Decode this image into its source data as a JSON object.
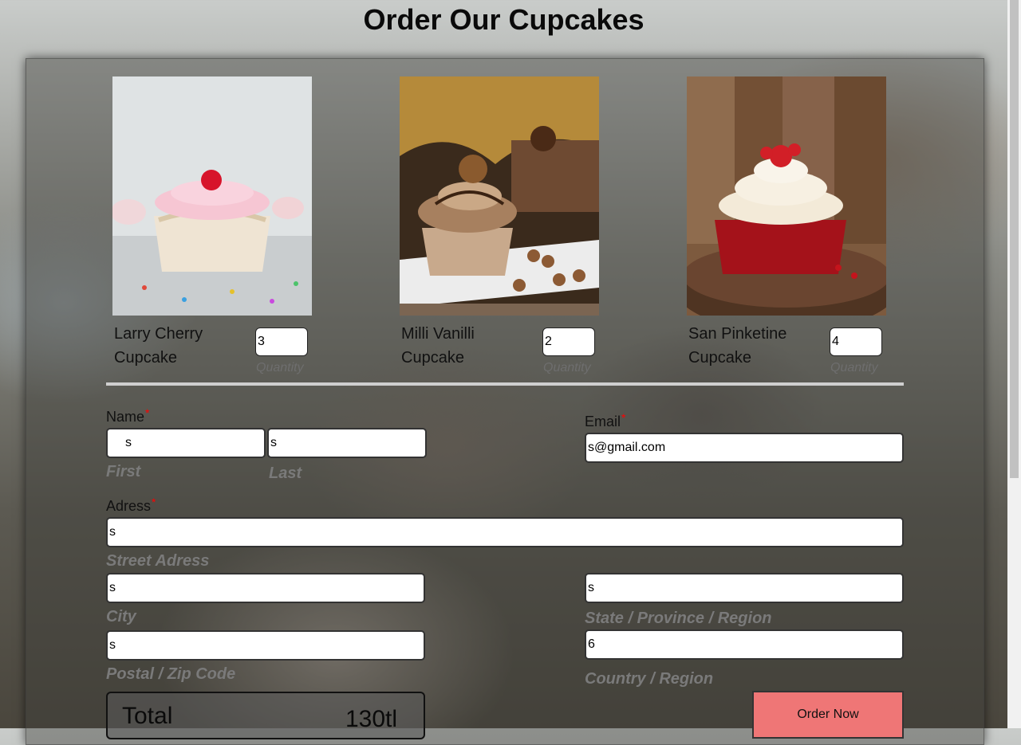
{
  "page": {
    "title": "Order Our Cupcakes"
  },
  "products": [
    {
      "name": "Larry Cherry Cupcake",
      "quantity": "3",
      "quantity_label": "Quantity"
    },
    {
      "name": "Milli Vanilli Cupcake",
      "quantity": "2",
      "quantity_label": "Quantity"
    },
    {
      "name": "San Pinketine Cupcake",
      "quantity": "4",
      "quantity_label": "Quantity"
    }
  ],
  "form": {
    "name": {
      "label": "Name",
      "required_mark": "*",
      "first_value": "s",
      "first_label": "First",
      "last_value": "s",
      "last_label": "Last"
    },
    "email": {
      "label": "Email",
      "required_mark": "*",
      "value": "s@gmail.com"
    },
    "address": {
      "label": "Adress",
      "required_mark": "*",
      "street_value": "s",
      "street_label": "Street Adress",
      "city_value": "s",
      "city_label": "City",
      "state_value": "s",
      "state_label": "State / Province / Region",
      "postal_value": "s",
      "postal_label": "Postal / Zip Code",
      "country_value": "6",
      "country_label": "Country / Region"
    }
  },
  "total": {
    "label": "Total",
    "value": "130tl"
  },
  "order_button": {
    "label": "Order Now"
  },
  "colors": {
    "button": "#ef7676",
    "required": "#ff0000"
  }
}
